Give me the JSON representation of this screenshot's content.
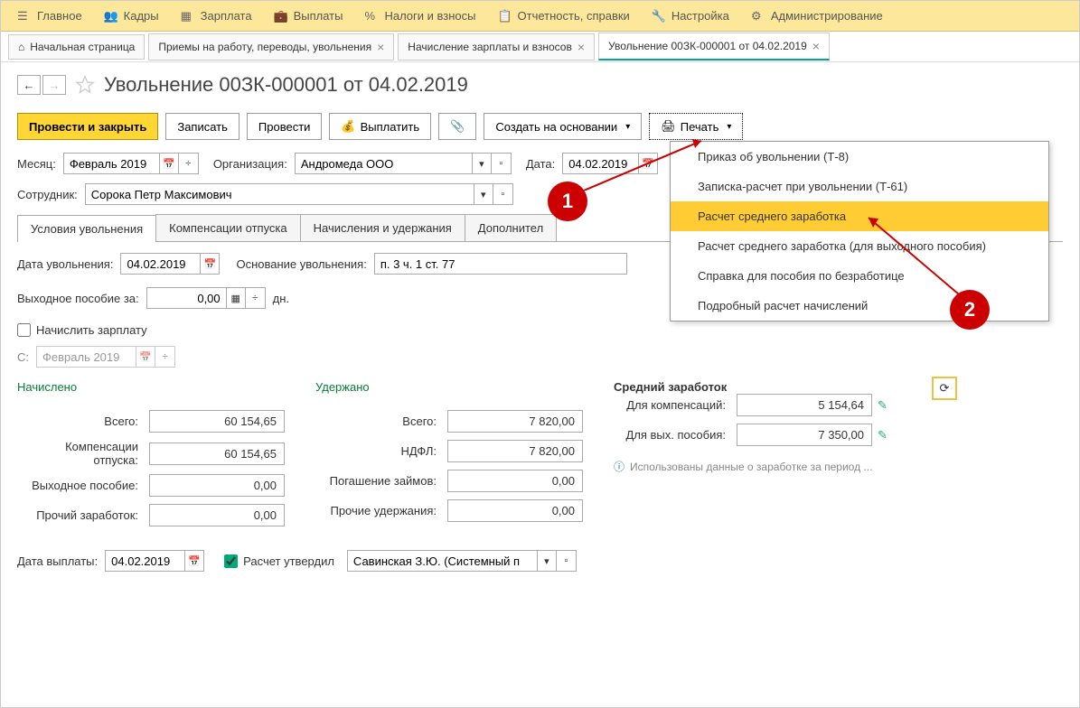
{
  "topmenu": [
    {
      "icon": "menu",
      "label": "Главное"
    },
    {
      "icon": "people",
      "label": "Кадры"
    },
    {
      "icon": "calendar",
      "label": "Зарплата"
    },
    {
      "icon": "wallet",
      "label": "Выплаты"
    },
    {
      "icon": "percent",
      "label": "Налоги и взносы"
    },
    {
      "icon": "report",
      "label": "Отчетность, справки"
    },
    {
      "icon": "wrench",
      "label": "Настройка"
    },
    {
      "icon": "gears",
      "label": "Администрирование"
    }
  ],
  "tabs": [
    {
      "label": "Начальная страница",
      "closable": false
    },
    {
      "label": "Приемы на работу, переводы, увольнения",
      "closable": true
    },
    {
      "label": "Начисление зарплаты и взносов",
      "closable": true
    },
    {
      "label": "Увольнение 00ЗК-000001 от 04.02.2019",
      "closable": true,
      "active": true
    }
  ],
  "page_title": "Увольнение 00ЗК-000001 от 04.02.2019",
  "toolbar": {
    "post_close": "Провести и закрыть",
    "save": "Записать",
    "post": "Провести",
    "pay": "Выплатить",
    "create_based": "Создать на основании",
    "print": "Печать"
  },
  "header_fields": {
    "month_label": "Месяц:",
    "month_value": "Февраль 2019",
    "org_label": "Организация:",
    "org_value": "Андромеда ООО",
    "date_label": "Дата:",
    "date_value": "04.02.2019",
    "emp_label": "Сотрудник:",
    "emp_value": "Сорока Петр Максимович"
  },
  "inner_tabs": [
    "Условия увольнения",
    "Компенсации отпуска",
    "Начисления и удержания",
    "Дополнител"
  ],
  "dismissal": {
    "date_label": "Дата увольнения:",
    "date_value": "04.02.2019",
    "reason_label": "Основание увольнения:",
    "reason_value": "п. 3 ч. 1 ст. 77",
    "severance_label": "Выходное пособие за:",
    "severance_value": "0,00",
    "severance_unit": "дн.",
    "accrue_salary_label": "Начислить зарплату",
    "from_label": "С:",
    "from_value": "Февраль 2019"
  },
  "totals": {
    "accrued": {
      "title": "Начислено",
      "rows": [
        {
          "label": "Всего:",
          "value": "60 154,65"
        },
        {
          "label": "Компенсации отпуска:",
          "value": "60 154,65"
        },
        {
          "label": "Выходное пособие:",
          "value": "0,00"
        },
        {
          "label": "Прочий заработок:",
          "value": "0,00"
        }
      ]
    },
    "withheld": {
      "title": "Удержано",
      "rows": [
        {
          "label": "Всего:",
          "value": "7 820,00"
        },
        {
          "label": "НДФЛ:",
          "value": "7 820,00"
        },
        {
          "label": "Погашение займов:",
          "value": "0,00"
        },
        {
          "label": "Прочие удержания:",
          "value": "0,00"
        }
      ]
    },
    "average": {
      "title": "Средний заработок",
      "rows": [
        {
          "label": "Для компенсаций:",
          "value": "5 154,64"
        },
        {
          "label": "Для вых. пособия:",
          "value": "7 350,00"
        }
      ],
      "note": "Использованы данные о заработке за период ..."
    }
  },
  "footer": {
    "paydate_label": "Дата выплаты:",
    "paydate_value": "04.02.2019",
    "approved_label": "Расчет утвердил",
    "approver": "Савинская З.Ю. (Системный п"
  },
  "print_menu": [
    "Приказ об увольнении (Т-8)",
    "Записка-расчет при увольнении (Т-61)",
    "Расчет среднего заработка",
    "Расчет среднего заработка (для выходного пособия)",
    "Справка для пособия по безработице",
    "Подробный расчет начислений"
  ],
  "callouts": [
    "1",
    "2"
  ]
}
